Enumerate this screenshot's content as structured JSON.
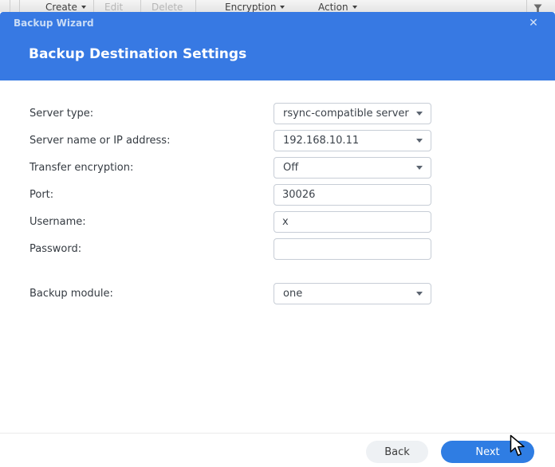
{
  "toolbar": {
    "items": [
      {
        "label": "Create",
        "has_caret": true,
        "disabled": false
      },
      {
        "label": "Edit",
        "has_caret": false,
        "disabled": true
      },
      {
        "label": "Delete",
        "has_caret": false,
        "disabled": true
      },
      {
        "label": "Encryption",
        "has_caret": true,
        "disabled": false
      },
      {
        "label": "Action",
        "has_caret": true,
        "disabled": false
      }
    ],
    "filter_icon": "funnel"
  },
  "dialog": {
    "title": "Backup Wizard",
    "close_icon": "✕",
    "heading": "Backup Destination Settings"
  },
  "form": {
    "rows": [
      {
        "label": "Server type:",
        "value": "rsync-compatible server",
        "control": "dropdown"
      },
      {
        "label": "Server name or IP address:",
        "value": "192.168.10.11",
        "control": "combobox"
      },
      {
        "label": "Transfer encryption:",
        "value": "Off",
        "control": "dropdown"
      },
      {
        "label": "Port:",
        "value": "30026",
        "control": "text"
      },
      {
        "label": "Username:",
        "value": "x",
        "control": "text"
      },
      {
        "label": "Password:",
        "value": "",
        "control": "password"
      },
      {
        "label": "Backup module:",
        "value": "one",
        "control": "dropdown"
      }
    ]
  },
  "footer": {
    "back_label": "Back",
    "next_label": "Next"
  },
  "colors": {
    "accent_blue": "#3779e3",
    "button_blue": "#2f7de3"
  }
}
